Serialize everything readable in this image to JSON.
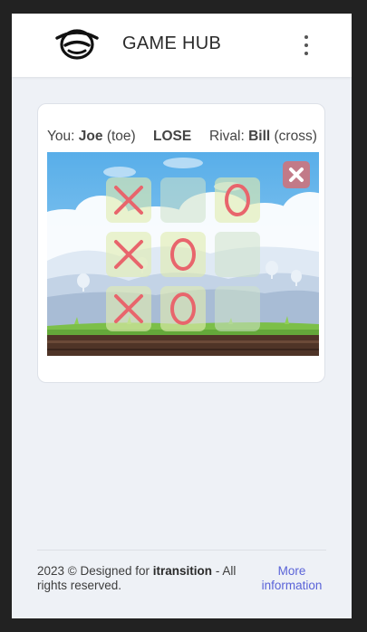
{
  "header": {
    "title": "GAME HUB",
    "logo_icon": "face-logo-icon",
    "menu_icon": "kebab-menu-icon"
  },
  "game": {
    "you_label": "You:",
    "you_name": "Joe",
    "you_role": "(toe)",
    "result": "LOSE",
    "rival_label": "Rival:",
    "rival_name": "Bill",
    "rival_role": "(cross)",
    "board": [
      [
        "X",
        "",
        "O"
      ],
      [
        "X",
        "O",
        ""
      ],
      [
        "X",
        "O",
        ""
      ]
    ],
    "close_icon": "close-icon",
    "colors": {
      "mark": "#e8656c",
      "close_button": "#c27a88"
    }
  },
  "footer": {
    "copyright_prefix": "2023 © Designed for",
    "company": "itransition",
    "copyright_suffix": "- All rights reserved.",
    "more_link": "More information"
  }
}
